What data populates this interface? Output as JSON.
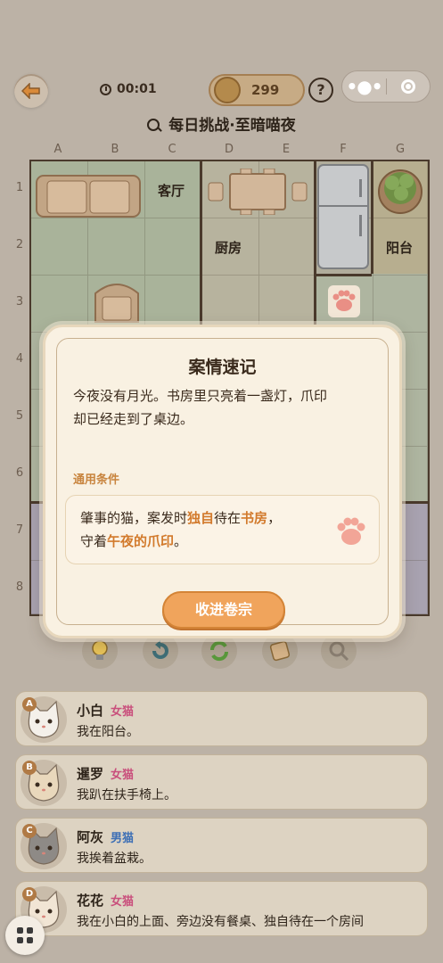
{
  "header": {
    "timer": "00:01",
    "coins": "299",
    "help_label": "?",
    "title": "每日挑战·至暗喵夜"
  },
  "board": {
    "columns": [
      "A",
      "B",
      "C",
      "D",
      "E",
      "F",
      "G"
    ],
    "rows": [
      "1",
      "2",
      "3",
      "4",
      "5",
      "6",
      "7",
      "8"
    ],
    "rooms": {
      "living": "客厅",
      "kitchen": "厨房",
      "balcony": "阳台"
    }
  },
  "tools": [
    "lightbulb-icon",
    "undo-icon",
    "refresh-icon",
    "scroll-icon",
    "magnifier-icon"
  ],
  "cats": [
    {
      "badge": "A",
      "name": "小白",
      "gender": "女猫",
      "gender_color": "#c94f7c",
      "desc": "我在阳台。"
    },
    {
      "badge": "B",
      "name": "暹罗",
      "gender": "女猫",
      "gender_color": "#c94f7c",
      "desc": "我趴在扶手椅上。"
    },
    {
      "badge": "C",
      "name": "阿灰",
      "gender": "男猫",
      "gender_color": "#3d6fb5",
      "desc": "我挨着盆栽。"
    },
    {
      "badge": "D",
      "name": "花花",
      "gender": "女猫",
      "gender_color": "#c94f7c",
      "desc": "我在小白的上面、旁边没有餐桌、独自待在一个房间"
    }
  ],
  "modal": {
    "title": "案情速记",
    "body_line1": "今夜没有月光。书房里只亮着一盏灯，爪印",
    "body_line2": "却已经走到了桌边。",
    "condition_label": "通用条件",
    "cond_1a": "肇事的猫，案发时",
    "cond_1b": "独自",
    "cond_1c": "待在",
    "cond_1d": "书房",
    "cond_1e": "，",
    "cond_2a": "守着",
    "cond_2b": "午夜的爪印",
    "cond_2c": "。",
    "button": "收进卷宗"
  },
  "colors": {
    "accent": "#f0a45c",
    "highlight": "#d27a2c",
    "female": "#c94f7c",
    "male": "#3d6fb5"
  }
}
